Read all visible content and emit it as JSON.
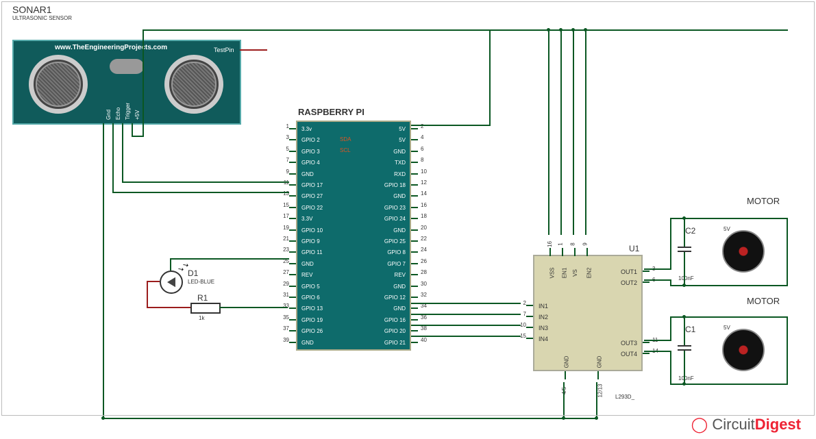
{
  "sonar": {
    "ref": "SONAR1",
    "desc": "ULTRASONIC SENSOR",
    "url": "www.TheEngineeringProjects.com",
    "testpin": "TestPin",
    "pins": [
      "Gnd",
      "Echo",
      "Trigger",
      "+5V"
    ]
  },
  "rpi": {
    "title": "RASPBERRY PI",
    "left_pins": [
      {
        "n": "1",
        "lbl": "3.3v"
      },
      {
        "n": "3",
        "lbl": "GPIO 2"
      },
      {
        "n": "5",
        "lbl": "GPIO 3"
      },
      {
        "n": "7",
        "lbl": "GPIO 4"
      },
      {
        "n": "9",
        "lbl": "GND"
      },
      {
        "n": "11",
        "lbl": "GPIO 17"
      },
      {
        "n": "13",
        "lbl": "GPIO 27"
      },
      {
        "n": "15",
        "lbl": "GPIO 22"
      },
      {
        "n": "17",
        "lbl": "3.3V"
      },
      {
        "n": "19",
        "lbl": "GPIO 10"
      },
      {
        "n": "21",
        "lbl": "GPIO 9"
      },
      {
        "n": "23",
        "lbl": "GPIO 11"
      },
      {
        "n": "25",
        "lbl": "GND"
      },
      {
        "n": "27",
        "lbl": "REV"
      },
      {
        "n": "29",
        "lbl": "GPIO 5"
      },
      {
        "n": "31",
        "lbl": "GPIO 6"
      },
      {
        "n": "33",
        "lbl": "GPIO 13"
      },
      {
        "n": "35",
        "lbl": "GPIO 19"
      },
      {
        "n": "37",
        "lbl": "GPIO 26"
      },
      {
        "n": "39",
        "lbl": "GND"
      }
    ],
    "right_pins": [
      {
        "n": "2",
        "lbl": "5V"
      },
      {
        "n": "4",
        "lbl": "5V"
      },
      {
        "n": "6",
        "lbl": "GND"
      },
      {
        "n": "8",
        "lbl": "TXD"
      },
      {
        "n": "10",
        "lbl": "RXD"
      },
      {
        "n": "12",
        "lbl": "GPIO 18"
      },
      {
        "n": "14",
        "lbl": "GND"
      },
      {
        "n": "16",
        "lbl": "GPIO 23"
      },
      {
        "n": "18",
        "lbl": "GPIO 24"
      },
      {
        "n": "20",
        "lbl": "GND"
      },
      {
        "n": "22",
        "lbl": "GPIO 25"
      },
      {
        "n": "24",
        "lbl": "GPIO 8"
      },
      {
        "n": "26",
        "lbl": "GPIO 7"
      },
      {
        "n": "28",
        "lbl": "REV"
      },
      {
        "n": "30",
        "lbl": "GND"
      },
      {
        "n": "32",
        "lbl": "GPIO 12"
      },
      {
        "n": "34",
        "lbl": "GND"
      },
      {
        "n": "36",
        "lbl": "GPIO 16"
      },
      {
        "n": "38",
        "lbl": "GPIO 20"
      },
      {
        "n": "40",
        "lbl": "GPIO 21"
      }
    ],
    "sda": "SDA",
    "scl": "SCL"
  },
  "u1": {
    "ref": "U1",
    "part": "L293D_",
    "top_pins": [
      {
        "n": "16",
        "lbl": "VSS"
      },
      {
        "n": "1",
        "lbl": "EN1"
      },
      {
        "n": "8",
        "lbl": "VS"
      },
      {
        "n": "9",
        "lbl": "EN2"
      }
    ],
    "left_pins": [
      {
        "n": "2",
        "lbl": "IN1"
      },
      {
        "n": "7",
        "lbl": "IN2"
      },
      {
        "n": "10",
        "lbl": "IN3"
      },
      {
        "n": "15",
        "lbl": "IN4"
      }
    ],
    "right_pins": [
      {
        "n": "3",
        "lbl": "OUT1"
      },
      {
        "n": "6",
        "lbl": "OUT2"
      },
      {
        "n": "11",
        "lbl": "OUT3"
      },
      {
        "n": "14",
        "lbl": "OUT4"
      }
    ],
    "bottom_pins": [
      {
        "n": "4/5",
        "lbl": "GND"
      },
      {
        "n": "12/13",
        "lbl": "GND"
      }
    ]
  },
  "d1": {
    "ref": "D1",
    "part": "LED-BLUE"
  },
  "r1": {
    "ref": "R1",
    "val": "1k"
  },
  "c1": {
    "ref": "C1",
    "val": "100nF"
  },
  "c2": {
    "ref": "C2",
    "val": "100nF"
  },
  "motor": {
    "label": "MOTOR",
    "volt": "5V"
  },
  "logo": {
    "brand1": "Circuit",
    "brand2": "Digest"
  }
}
